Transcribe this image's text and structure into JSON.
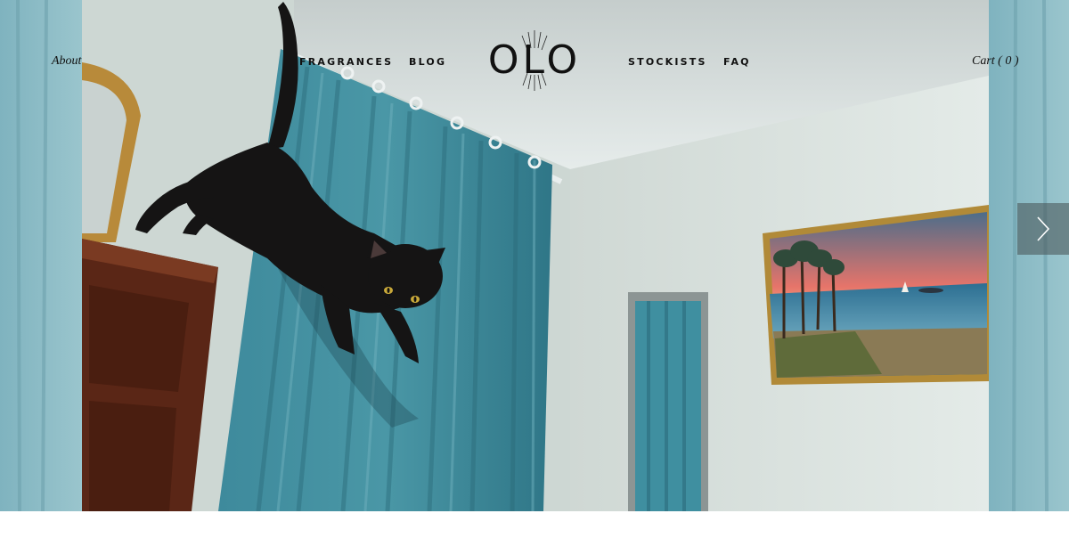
{
  "nav": {
    "about": "About",
    "fragrances": "FRAGRANCES",
    "blog": "BLOG",
    "stockists": "STOCKISTS",
    "faq": "FAQ",
    "cart": "Cart ( 0 )"
  },
  "logo": {
    "text": "OLO"
  },
  "slideshow": {
    "next_icon": "chevron-right-icon",
    "subject": "black cat leaping in front of teal curtains"
  },
  "colors": {
    "curtain": "#3f8a9a",
    "wall": "#dfe5e2",
    "nav_text": "#111111",
    "arrow_bg": "#46505299"
  }
}
